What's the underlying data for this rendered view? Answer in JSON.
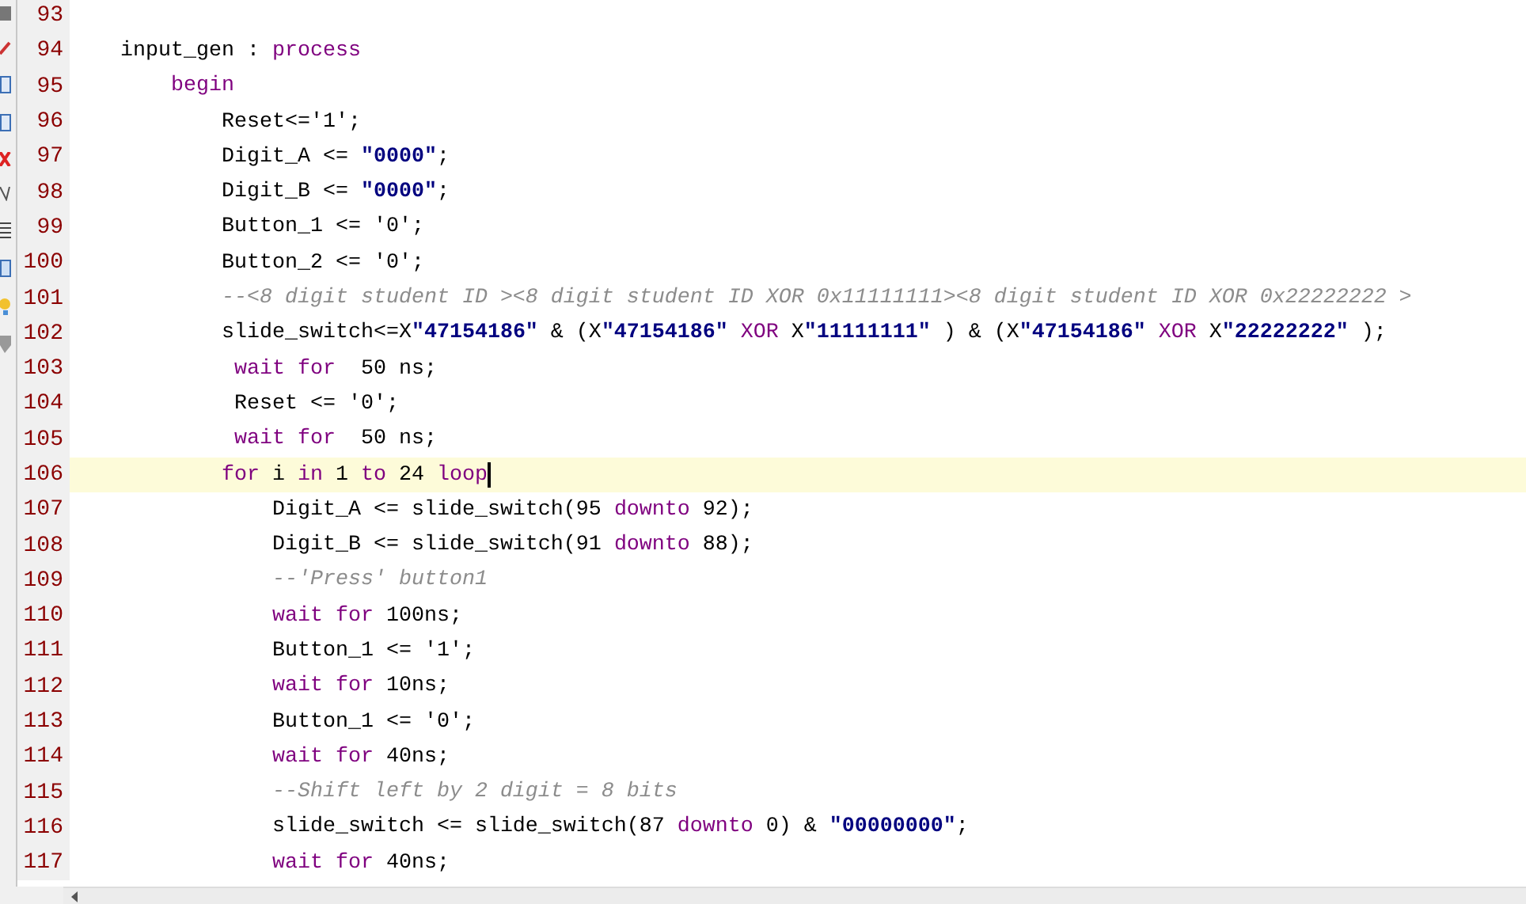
{
  "lines": [
    {
      "number": "93",
      "current": false
    },
    {
      "number": "94",
      "current": false,
      "tokens": [
        {
          "kind": "plain",
          "text": "    input_gen : "
        },
        {
          "kind": "keyword",
          "text": "process"
        }
      ]
    },
    {
      "number": "95",
      "current": false,
      "tokens": [
        {
          "kind": "keyword",
          "text": "        begin"
        }
      ]
    },
    {
      "number": "96",
      "current": false,
      "tokens": [
        {
          "kind": "plain",
          "text": "            Reset<='1';"
        }
      ]
    },
    {
      "number": "97",
      "current": false,
      "tokens": [
        {
          "kind": "plain",
          "text": "            Digit_A <= "
        },
        {
          "kind": "string",
          "text": "\"0000\""
        },
        {
          "kind": "plain",
          "text": ";"
        }
      ]
    },
    {
      "number": "98",
      "current": false,
      "tokens": [
        {
          "kind": "plain",
          "text": "            Digit_B <= "
        },
        {
          "kind": "string",
          "text": "\"0000\""
        },
        {
          "kind": "plain",
          "text": ";"
        }
      ]
    },
    {
      "number": "99",
      "current": false,
      "tokens": [
        {
          "kind": "plain",
          "text": "            Button_1 <= '0';"
        }
      ]
    },
    {
      "number": "100",
      "current": false,
      "tokens": [
        {
          "kind": "plain",
          "text": "            Button_2 <= '0';"
        }
      ]
    },
    {
      "number": "101",
      "current": false,
      "tokens": [
        {
          "kind": "comment",
          "text": "            --<8 digit student ID ><8 digit student ID XOR 0x11111111><8 digit student ID XOR 0x22222222 >"
        }
      ]
    },
    {
      "number": "102",
      "current": false,
      "tokens": [
        {
          "kind": "plain",
          "text": "            slide_switch<=X"
        },
        {
          "kind": "string",
          "text": "\"47154186\""
        },
        {
          "kind": "plain",
          "text": " & (X"
        },
        {
          "kind": "string",
          "text": "\"47154186\""
        },
        {
          "kind": "keyword",
          "text": " XOR"
        },
        {
          "kind": "plain",
          "text": " X"
        },
        {
          "kind": "string",
          "text": "\"11111111\""
        },
        {
          "kind": "plain",
          "text": " ) & (X"
        },
        {
          "kind": "string",
          "text": "\"47154186\""
        },
        {
          "kind": "keyword",
          "text": " XOR"
        },
        {
          "kind": "plain",
          "text": " X"
        },
        {
          "kind": "string",
          "text": "\"22222222\""
        },
        {
          "kind": "plain",
          "text": " );"
        }
      ]
    },
    {
      "number": "103",
      "current": false,
      "tokens": [
        {
          "kind": "keyword",
          "text": "             wait for"
        },
        {
          "kind": "plain",
          "text": "  50 ns;"
        }
      ]
    },
    {
      "number": "104",
      "current": false,
      "tokens": [
        {
          "kind": "plain",
          "text": "             Reset <= '0';"
        }
      ]
    },
    {
      "number": "105",
      "current": false,
      "tokens": [
        {
          "kind": "keyword",
          "text": "             wait for"
        },
        {
          "kind": "plain",
          "text": "  50 ns;"
        }
      ]
    },
    {
      "number": "106",
      "current": true,
      "tokens": [
        {
          "kind": "keyword",
          "text": "            for"
        },
        {
          "kind": "plain",
          "text": " i "
        },
        {
          "kind": "keyword",
          "text": "in"
        },
        {
          "kind": "plain",
          "text": " 1 "
        },
        {
          "kind": "keyword",
          "text": "to"
        },
        {
          "kind": "plain",
          "text": " 24 "
        },
        {
          "kind": "keyword",
          "text": "loop"
        }
      ]
    },
    {
      "number": "107",
      "current": false,
      "tokens": [
        {
          "kind": "plain",
          "text": "                Digit_A <= slide_switch(95 "
        },
        {
          "kind": "keyword",
          "text": "downto"
        },
        {
          "kind": "plain",
          "text": " 92);"
        }
      ]
    },
    {
      "number": "108",
      "current": false,
      "tokens": [
        {
          "kind": "plain",
          "text": "                Digit_B <= slide_switch(91 "
        },
        {
          "kind": "keyword",
          "text": "downto"
        },
        {
          "kind": "plain",
          "text": " 88);"
        }
      ]
    },
    {
      "number": "109",
      "current": false,
      "tokens": [
        {
          "kind": "comment",
          "text": "                --'Press' button1"
        }
      ]
    },
    {
      "number": "110",
      "current": false,
      "tokens": [
        {
          "kind": "keyword",
          "text": "                wait for"
        },
        {
          "kind": "plain",
          "text": " 100ns;"
        }
      ]
    },
    {
      "number": "111",
      "current": false,
      "tokens": [
        {
          "kind": "plain",
          "text": "                Button_1 <= '1';"
        }
      ]
    },
    {
      "number": "112",
      "current": false,
      "tokens": [
        {
          "kind": "keyword",
          "text": "                wait for"
        },
        {
          "kind": "plain",
          "text": " 10ns;"
        }
      ]
    },
    {
      "number": "113",
      "current": false,
      "tokens": [
        {
          "kind": "plain",
          "text": "                Button_1 <= '0';"
        }
      ]
    },
    {
      "number": "114",
      "current": false,
      "tokens": [
        {
          "kind": "keyword",
          "text": "                wait for"
        },
        {
          "kind": "plain",
          "text": " 40ns;"
        }
      ]
    },
    {
      "number": "115",
      "current": false,
      "tokens": [
        {
          "kind": "comment",
          "text": "                --Shift left by 2 digit = 8 bits"
        }
      ]
    },
    {
      "number": "116",
      "current": false,
      "tokens": [
        {
          "kind": "plain",
          "text": "                slide_switch <= slide_switch(87 "
        },
        {
          "kind": "keyword",
          "text": "downto"
        },
        {
          "kind": "plain",
          "text": " 0) & "
        },
        {
          "kind": "string",
          "text": "\"00000000\""
        },
        {
          "kind": "plain",
          "text": ";"
        }
      ]
    },
    {
      "number": "117",
      "current": false,
      "tokens": [
        {
          "kind": "keyword",
          "text": "                wait for"
        },
        {
          "kind": "plain",
          "text": " 40ns;"
        }
      ]
    }
  ]
}
